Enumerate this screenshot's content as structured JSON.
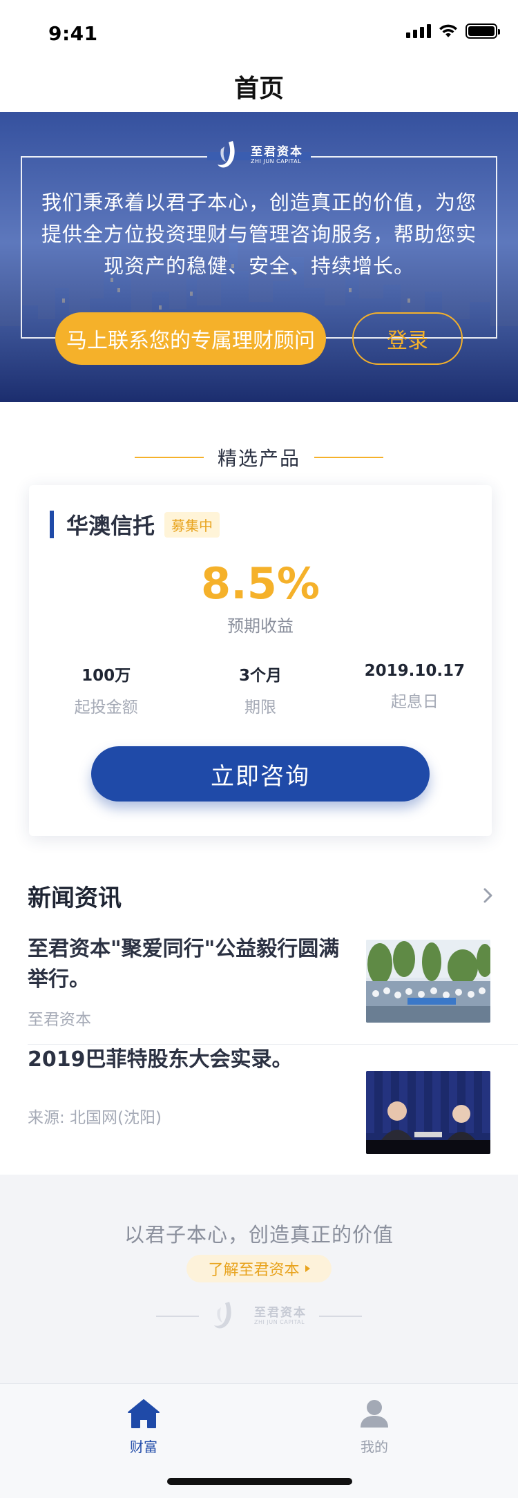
{
  "status_bar": {
    "time": "9:41"
  },
  "nav": {
    "title": "首页"
  },
  "hero": {
    "brand_cn": "至君资本",
    "brand_en": "ZHI JUN CAPITAL",
    "intro": "我们秉承着以君子本心，创造真正的价值，为您提供全方位投资理财与管理咨询服务，帮助您实现资产的稳健、安全、持续增长。",
    "contact_button": "马上联系您的专属理财顾问",
    "login_button": "登录"
  },
  "featured": {
    "section_label": "精选产品",
    "product": {
      "name": "华澳信托",
      "status": "募集中",
      "yield": "8.5%",
      "yield_label": "预期收益",
      "stats": [
        {
          "value": "100万",
          "label": "起投金额"
        },
        {
          "value": "3个月",
          "label": "期限"
        },
        {
          "value": "2019.10.17",
          "label": "起息日"
        }
      ],
      "consult_button": "立即咨询"
    }
  },
  "news": {
    "title": "新闻资讯",
    "items": [
      {
        "headline": "至君资本\"聚爱同行\"公益毅行圆满举行。",
        "source": "至君资本"
      },
      {
        "headline": "2019巴菲特股东大会实录。",
        "source": "来源: 北国网(沈阳)"
      }
    ]
  },
  "footer": {
    "slogan": "以君子本心，创造真正的价值",
    "about_button": "了解至君资本",
    "brand_cn": "至君资本",
    "brand_en": "ZHI JUN CAPITAL"
  },
  "tab_bar": {
    "tabs": [
      {
        "label": "财富",
        "icon": "home-icon",
        "active": true
      },
      {
        "label": "我的",
        "icon": "user-icon",
        "active": false
      }
    ]
  },
  "colors": {
    "primary": "#1f4aa8",
    "accent": "#f5b12a",
    "footer_bg": "#f3f4f7"
  }
}
